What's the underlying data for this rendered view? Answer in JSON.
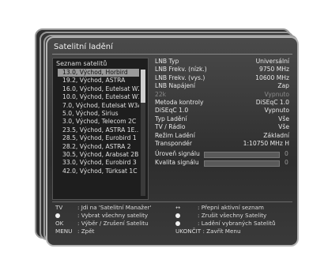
{
  "window": {
    "title": "Satelitní ladění"
  },
  "satellite_list": {
    "header": "Seznam satelitů",
    "items": [
      "13.0, Východ, Horbird",
      "19.2, Východ, ASTRA",
      "16.0, Východ, Eutelsat W2",
      "10.0, Východ, Eutelsat W1",
      "7.0, Východ, Eutelsat W3A",
      "5.0, Východ, Sirius",
      "3.0, Východ, Telecom 2C",
      "23.5, Východ, ASTRA 1E...",
      "28.5, Východ, Eurobird 1",
      "28.2, Východ, ASTRA 2",
      "30.5, Východ, Arabsat 2B",
      "33.0, Východ, Eurobird 3",
      "42.0, Východ, Türksat 1C"
    ],
    "selected_index": 0
  },
  "params": [
    {
      "label": "LNB Typ",
      "value": "Universální",
      "dim": false
    },
    {
      "label": "LNB Frekv. (nízk.)",
      "value": "9750 MHz",
      "dim": false
    },
    {
      "label": "LNB Frekv. (vys.)",
      "value": "10600 MHz",
      "dim": false
    },
    {
      "label": "LNB Napájení",
      "value": "Zap",
      "dim": false
    },
    {
      "label": "22k",
      "value": "Vypnuto",
      "dim": true
    },
    {
      "label": "Metoda kontroly",
      "value": "DiSEqC 1.0",
      "dim": false
    },
    {
      "label": "DiSEqC 1.0",
      "value": "Vypnuto",
      "dim": false
    },
    {
      "label": "Typ Ladění",
      "value": "Vše",
      "dim": false
    },
    {
      "label": "TV / Rádio",
      "value": "Vše",
      "dim": false
    },
    {
      "label": "Režim Ladění",
      "value": "Základní",
      "dim": false
    },
    {
      "label": "Transpondér",
      "value": "1:10750 MHz H",
      "dim": false
    }
  ],
  "signal": {
    "level_label": "Úroveň signálu",
    "level_value": "0",
    "level_fraction": 0,
    "quality_label": "Kvalita signálu",
    "quality_value": "0",
    "quality_fraction": 0
  },
  "help": {
    "tv_key": "TV",
    "tv_desc": ": Jdi na 'Satelitní Manažer'",
    "red_desc": ": Vybrat všechny satelity",
    "ok_key": "OK",
    "ok_desc": ": Výběr / Zrušení Satelitu",
    "menu_key": "MENU",
    "menu_desc": ": Zpět",
    "lr_key": "↔",
    "lr_desc": ": Přepni aktivní seznam",
    "white1_desc": ": Zrušit všechny Satelity",
    "white2_desc": ": Ladění vybraných Satelitů",
    "exit_key": "UKONČIT",
    "exit_desc": ": Zavřít Menu"
  }
}
